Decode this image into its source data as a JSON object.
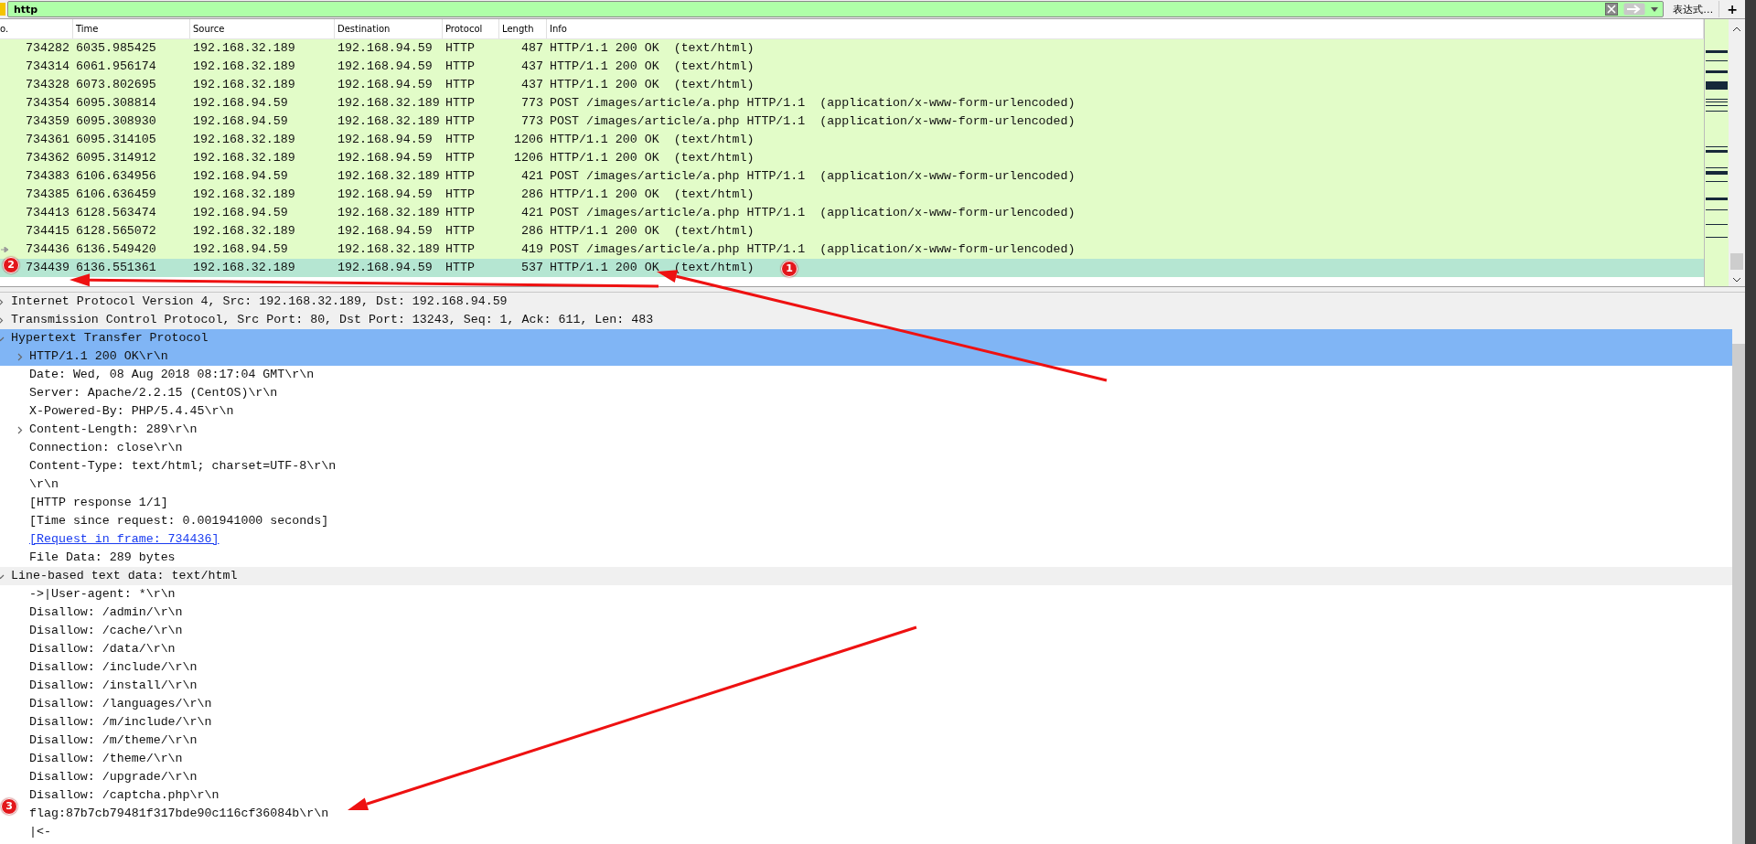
{
  "filter_bar": {
    "value": "http",
    "expression_button": "表达式…",
    "add_button": "+"
  },
  "packet_list": {
    "columns": [
      "o.",
      "Time",
      "Source",
      "Destination",
      "Protocol",
      "Length",
      "Info"
    ],
    "rows": [
      {
        "cells": [
          "734282",
          "6035.985425",
          "192.168.32.189",
          "192.168.94.59",
          "HTTP",
          "487",
          "HTTP/1.1 200 OK  (text/html)"
        ],
        "selected": false,
        "related": false
      },
      {
        "cells": [
          "734314",
          "6061.956174",
          "192.168.32.189",
          "192.168.94.59",
          "HTTP",
          "437",
          "HTTP/1.1 200 OK  (text/html)"
        ],
        "selected": false,
        "related": false
      },
      {
        "cells": [
          "734328",
          "6073.802695",
          "192.168.32.189",
          "192.168.94.59",
          "HTTP",
          "437",
          "HTTP/1.1 200 OK  (text/html)"
        ],
        "selected": false,
        "related": false
      },
      {
        "cells": [
          "734354",
          "6095.308814",
          "192.168.94.59",
          "192.168.32.189",
          "HTTP",
          "773",
          "POST /images/article/a.php HTTP/1.1  (application/x-www-form-urlencoded)"
        ],
        "selected": false,
        "related": false
      },
      {
        "cells": [
          "734359",
          "6095.308930",
          "192.168.94.59",
          "192.168.32.189",
          "HTTP",
          "773",
          "POST /images/article/a.php HTTP/1.1  (application/x-www-form-urlencoded)"
        ],
        "selected": false,
        "related": false
      },
      {
        "cells": [
          "734361",
          "6095.314105",
          "192.168.32.189",
          "192.168.94.59",
          "HTTP",
          "1206",
          "HTTP/1.1 200 OK  (text/html)"
        ],
        "selected": false,
        "related": false
      },
      {
        "cells": [
          "734362",
          "6095.314912",
          "192.168.32.189",
          "192.168.94.59",
          "HTTP",
          "1206",
          "HTTP/1.1 200 OK  (text/html)"
        ],
        "selected": false,
        "related": false
      },
      {
        "cells": [
          "734383",
          "6106.634956",
          "192.168.94.59",
          "192.168.32.189",
          "HTTP",
          "421",
          "POST /images/article/a.php HTTP/1.1  (application/x-www-form-urlencoded)"
        ],
        "selected": false,
        "related": false
      },
      {
        "cells": [
          "734385",
          "6106.636459",
          "192.168.32.189",
          "192.168.94.59",
          "HTTP",
          "286",
          "HTTP/1.1 200 OK  (text/html)"
        ],
        "selected": false,
        "related": false
      },
      {
        "cells": [
          "734413",
          "6128.563474",
          "192.168.94.59",
          "192.168.32.189",
          "HTTP",
          "421",
          "POST /images/article/a.php HTTP/1.1  (application/x-www-form-urlencoded)"
        ],
        "selected": false,
        "related": false
      },
      {
        "cells": [
          "734415",
          "6128.565072",
          "192.168.32.189",
          "192.168.94.59",
          "HTTP",
          "286",
          "HTTP/1.1 200 OK  (text/html)"
        ],
        "selected": false,
        "related": false
      },
      {
        "cells": [
          "734436",
          "6136.549420",
          "192.168.94.59",
          "192.168.32.189",
          "HTTP",
          "419",
          "POST /images/article/a.php HTTP/1.1  (application/x-www-form-urlencoded)"
        ],
        "selected": false,
        "related": true
      },
      {
        "cells": [
          "734439",
          "6136.551361",
          "192.168.32.189",
          "192.168.94.59",
          "HTTP",
          "537",
          "HTTP/1.1 200 OK  (text/html)"
        ],
        "selected": true,
        "related": false
      }
    ]
  },
  "details": [
    {
      "label": "Internet Protocol Version 4, Src: 192.168.32.189, Dst: 192.168.94.59",
      "expanded": false,
      "selected": false
    },
    {
      "label": "Transmission Control Protocol, Src Port: 80, Dst Port: 13243, Seq: 1, Ack: 611, Len: 483",
      "expanded": false,
      "selected": false
    },
    {
      "label": "Hypertext Transfer Protocol",
      "expanded": true,
      "selected": true,
      "children": [
        {
          "label": "HTTP/1.1 200 OK\\r\\n",
          "expanded": false,
          "selected": true
        },
        {
          "label": "Date: Wed, 08 Aug 2018 08:17:04 GMT\\r\\n",
          "selected": false
        },
        {
          "label": "Server: Apache/2.2.15 (CentOS)\\r\\n",
          "selected": false
        },
        {
          "label": "X-Powered-By: PHP/5.4.45\\r\\n",
          "selected": false
        },
        {
          "label": "Content-Length: 289\\r\\n",
          "expanded": false,
          "selected": false
        },
        {
          "label": "Connection: close\\r\\n",
          "selected": false
        },
        {
          "label": "Content-Type: text/html; charset=UTF-8\\r\\n",
          "selected": false
        },
        {
          "label": "\\r\\n",
          "selected": false
        },
        {
          "label": "[HTTP response 1/1]",
          "selected": false
        },
        {
          "label": "[Time since request: 0.001941000 seconds]",
          "selected": false
        },
        {
          "label": "[Request in frame: 734436]",
          "selected": false,
          "kind": "link"
        },
        {
          "label": "File Data: 289 bytes",
          "selected": false
        }
      ]
    },
    {
      "label": "Line-based text data: text/html",
      "expanded": true,
      "selected": false,
      "children": [
        {
          "label": "->|User-agent: *\\r\\n",
          "selected": false
        },
        {
          "label": "Disallow: /admin/\\r\\n",
          "selected": false
        },
        {
          "label": "Disallow: /cache/\\r\\n",
          "selected": false
        },
        {
          "label": "Disallow: /data/\\r\\n",
          "selected": false
        },
        {
          "label": "Disallow: /include/\\r\\n",
          "selected": false
        },
        {
          "label": "Disallow: /install/\\r\\n",
          "selected": false
        },
        {
          "label": "Disallow: /languages/\\r\\n",
          "selected": false
        },
        {
          "label": "Disallow: /m/include/\\r\\n",
          "selected": false
        },
        {
          "label": "Disallow: /m/theme/\\r\\n",
          "selected": false
        },
        {
          "label": "Disallow: /theme/\\r\\n",
          "selected": false
        },
        {
          "label": "Disallow: /upgrade/\\r\\n",
          "selected": false
        },
        {
          "label": "Disallow: /captcha.php\\r\\n",
          "selected": false
        },
        {
          "label": "flag:87b7cb79481f317bde90c116cf36084b\\r\\n",
          "selected": false
        },
        {
          "label": "|<-",
          "selected": false
        }
      ]
    }
  ],
  "annotations": [
    {
      "number": "1"
    },
    {
      "number": "2"
    },
    {
      "number": "3"
    }
  ]
}
